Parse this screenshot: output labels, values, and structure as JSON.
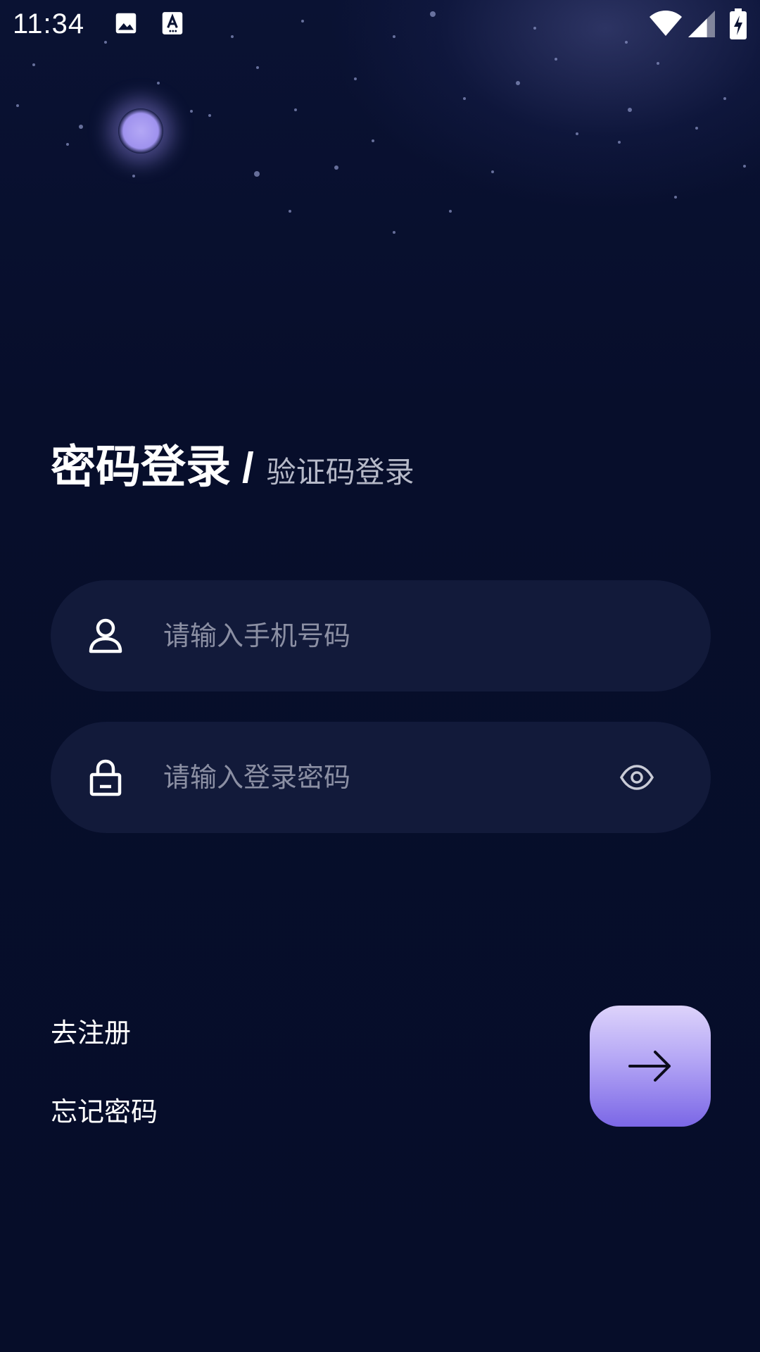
{
  "status_bar": {
    "time": "11:34",
    "left_icons": [
      "image-icon",
      "keyboard-a-icon"
    ],
    "right_icons": [
      "wifi-icon",
      "signal-icon",
      "battery-charging-icon"
    ]
  },
  "login": {
    "title_active": "密码登录",
    "title_separator": "/",
    "title_alt": "验证码登录",
    "phone_field": {
      "placeholder": "请输入手机号码",
      "value": "",
      "icon": "user-icon"
    },
    "password_field": {
      "placeholder": "请输入登录密码",
      "value": "",
      "icon": "lock-icon",
      "toggle_icon": "eye-icon"
    },
    "register_link": "去注册",
    "forgot_link": "忘记密码",
    "submit_icon": "arrow-right-icon"
  },
  "colors": {
    "background": "#060d29",
    "field_background": "#121a3a",
    "accent_gradient_top": "#ddd3fb",
    "accent_gradient_bottom": "#7b67e6",
    "placeholder": "#8b8fa3"
  }
}
